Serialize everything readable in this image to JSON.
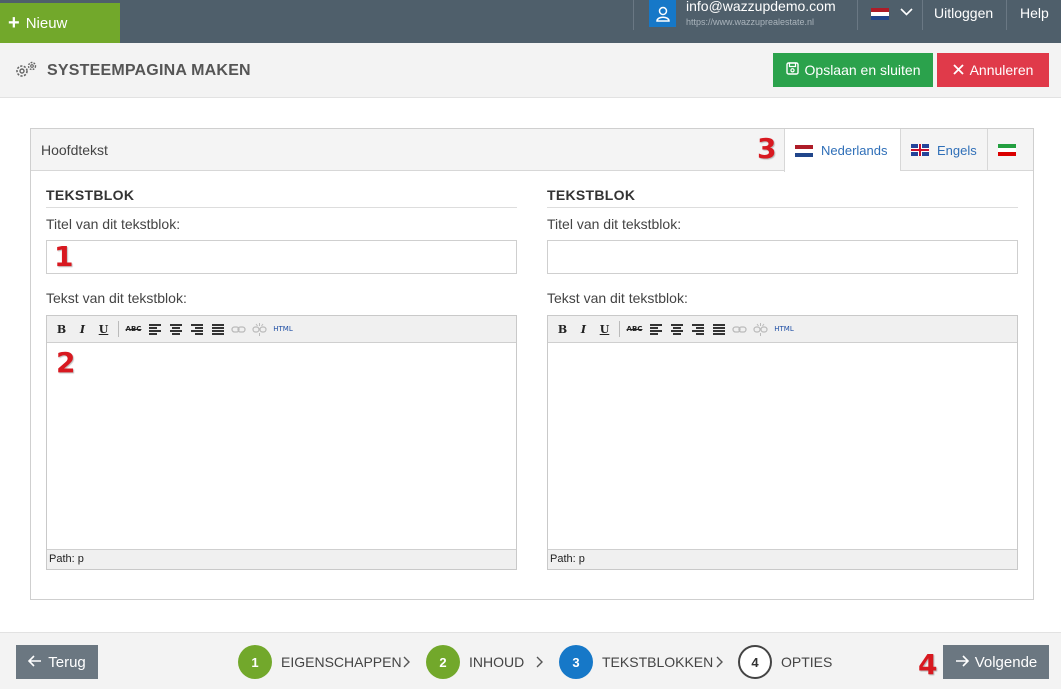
{
  "topbar": {
    "new_label": "Nieuw",
    "user_email": "info@wazzupdemo.com",
    "user_site": "https://www.wazzuprealestate.nl",
    "logout_label": "Uitloggen",
    "help_label": "Help",
    "bg_color": "#4f5f6b",
    "new_color": "#72a82b"
  },
  "header": {
    "title": "SYSTEEMPAGINA MAKEN",
    "save_label": "Opslaan en sluiten",
    "cancel_label": "Annuleren",
    "save_color": "#2ba24c",
    "cancel_color": "#e03a4a"
  },
  "panel": {
    "title": "Hoofdtekst",
    "tabs": [
      {
        "label": "Nederlands",
        "icon": "flag-nl-icon"
      },
      {
        "label": "Engels",
        "icon": "flag-uk-icon"
      },
      {
        "label": "",
        "icon": "flag-ir-icon"
      }
    ],
    "columns": [
      {
        "heading": "TEKSTBLOK",
        "title_label": "Titel van dit tekstblok:",
        "title_value": "",
        "text_label": "Tekst van dit tekstblok:",
        "path": "Path: p"
      },
      {
        "heading": "TEKSTBLOK",
        "title_label": "Titel van dit tekstblok:",
        "title_value": "",
        "text_label": "Tekst van dit tekstblok:",
        "path": "Path: p"
      }
    ],
    "toolbar": {
      "bold": "B",
      "italic": "I",
      "underline": "U",
      "strike": "ABC",
      "html": "HTML"
    }
  },
  "markers": [
    "1",
    "2",
    "3",
    "4"
  ],
  "footer": {
    "back_label": "Terug",
    "next_label": "Volgende",
    "steps": [
      {
        "num": "1",
        "label": "EIGENSCHAPPEN",
        "state": "done",
        "color": "#72a82b"
      },
      {
        "num": "2",
        "label": "INHOUD",
        "state": "done",
        "color": "#72a82b"
      },
      {
        "num": "3",
        "label": "TEKSTBLOKKEN",
        "state": "active",
        "color": "#1678c8"
      },
      {
        "num": "4",
        "label": "OPTIES",
        "state": "todo",
        "color": "#ffffff"
      }
    ]
  }
}
